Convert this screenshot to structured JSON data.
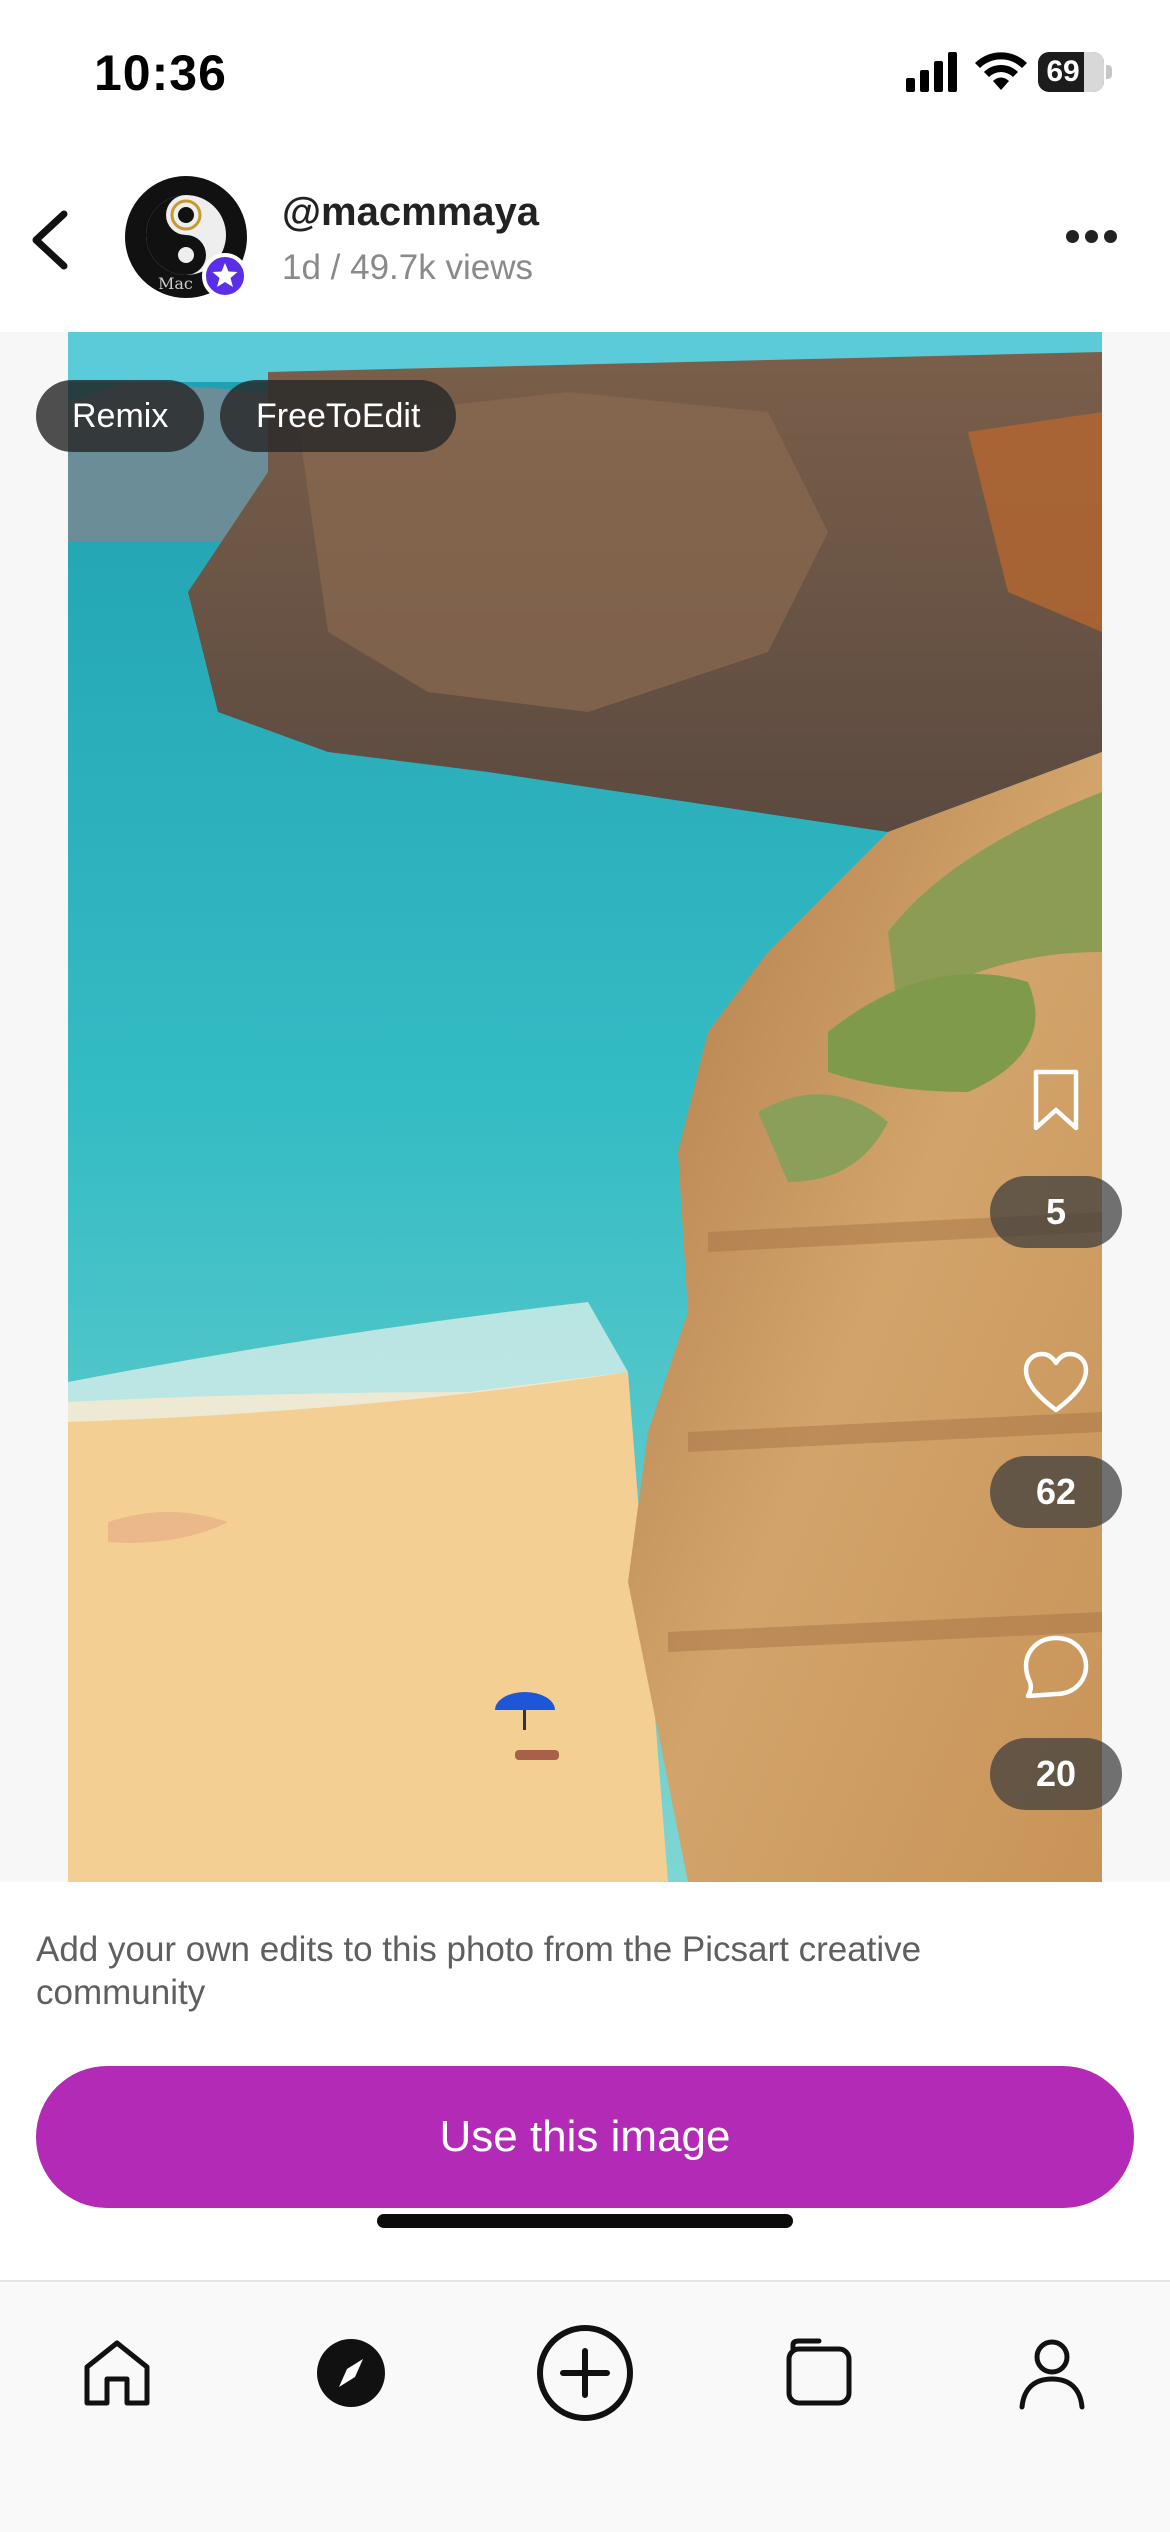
{
  "status_bar": {
    "time": "10:36",
    "battery": "69",
    "battery_level": 0.69
  },
  "header": {
    "username": "@macmmaya",
    "meta": "1d / 49.7k views",
    "back_icon": "chevron-left-icon",
    "more_icon": "ellipsis-icon",
    "avatar_text": "Mac"
  },
  "post": {
    "tags": [
      "Remix",
      "FreeToEdit"
    ],
    "save_count": "5",
    "like_count": "62",
    "comment_count": "20",
    "icons": {
      "save": "bookmark-icon",
      "like": "heart-icon",
      "comment": "comment-icon"
    }
  },
  "description": "Add your own edits to this photo from the Picsart creative community",
  "cta_label": "Use this image",
  "colors": {
    "cta": "#b22ab5",
    "badge": "#5b2ee8"
  },
  "bottom_nav": {
    "items": [
      "home-icon",
      "explore-icon",
      "create-icon",
      "collections-icon",
      "profile-icon"
    ]
  }
}
